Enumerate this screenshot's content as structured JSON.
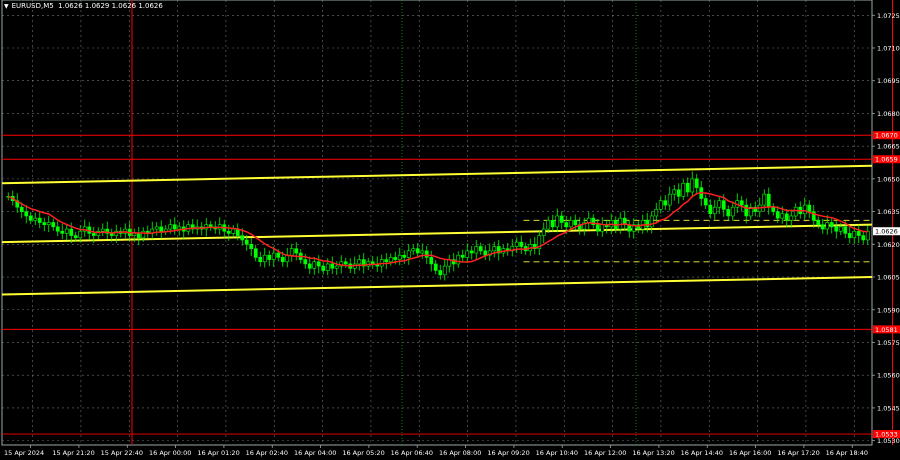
{
  "header": {
    "symbol": "EURUSD,M5",
    "ohlc": "1.0626 1.0629 1.0626 1.0626",
    "arrow": "▼"
  },
  "colors": {
    "background": "#000000",
    "grid": "#9aa7a7",
    "candle": "#00ff00",
    "ma": "#ff2020",
    "channel": "#ffff33",
    "level_line": "#ff0000",
    "session_line": "#ff0000",
    "session_dotted": "#00aa00",
    "price_label_bg": "#ff0000",
    "current_price_bg": "#ffffff"
  },
  "chart_data": {
    "type": "candlestick",
    "symbol": "EURUSD",
    "timeframe": "M5",
    "ylim": [
      1.0528,
      1.0732
    ],
    "y_ticks": [
      "1.0725",
      "1.0710",
      "1.0695",
      "1.0680",
      "1.0665",
      "1.0650",
      "1.0635",
      "1.0620",
      "1.0605",
      "1.0590",
      "1.0575",
      "1.0560",
      "1.0545",
      "1.0530"
    ],
    "x_ticks": [
      "15 Apr 2024",
      "15 Apr 21:20",
      "15 Apr 22:40",
      "16 Apr 00:00",
      "16 Apr 01:20",
      "16 Apr 02:40",
      "16 Apr 04:00",
      "16 Apr 05:20",
      "16 Apr 06:40",
      "16 Apr 08:00",
      "16 Apr 09:20",
      "16 Apr 10:40",
      "16 Apr 12:00",
      "16 Apr 13:20",
      "16 Apr 14:40",
      "16 Apr 16:00",
      "16 Apr 17:20",
      "16 Apr 18:40"
    ],
    "price_labels": [
      {
        "text": "1.0670",
        "value": 1.067
      },
      {
        "text": "1.0659",
        "value": 1.0659
      },
      {
        "text": "1.0581",
        "value": 1.0581
      },
      {
        "text": "1.0533",
        "value": 1.0533
      }
    ],
    "current_price": {
      "text": "1.0626",
      "value": 1.0626
    },
    "horizontal_levels": [
      1.067,
      1.0659,
      1.0581,
      1.0533
    ],
    "channel_lines": [
      {
        "x_start": 0,
        "x_end": 216,
        "y_start": 1.0648,
        "y_end": 1.0656
      },
      {
        "x_start": 0,
        "x_end": 216,
        "y_start": 1.0621,
        "y_end": 1.0629
      },
      {
        "x_start": 0,
        "x_end": 216,
        "y_start": 1.0597,
        "y_end": 1.0605
      }
    ],
    "dashed_levels": [
      1.0631,
      1.0612
    ],
    "session_lines": [
      28,
      197
    ],
    "close_series": [
      1.0642,
      1.064,
      1.0637,
      1.0635,
      1.0633,
      1.0631,
      1.0632,
      1.063,
      1.0629,
      1.063,
      1.0628,
      1.0626,
      1.0625,
      1.0627,
      1.0624,
      1.0623,
      1.0626,
      1.0628,
      1.0625,
      1.0624,
      1.0626,
      1.0627,
      1.0625,
      1.0624,
      1.0626,
      1.0625,
      1.0627,
      1.0624,
      1.0625,
      1.0623,
      1.0626,
      1.0625,
      1.0627,
      1.0628,
      1.0626,
      1.0627,
      1.0629,
      1.0627,
      1.0628,
      1.0626,
      1.0629,
      1.0627,
      1.0628,
      1.0627,
      1.0629,
      1.0628,
      1.0627,
      1.0629,
      1.0626,
      1.0625,
      1.0627,
      1.0624,
      1.0622,
      1.062,
      1.0618,
      1.0614,
      1.0612,
      1.0615,
      1.0613,
      1.0616,
      1.0614,
      1.0612,
      1.0615,
      1.0618,
      1.0616,
      1.0613,
      1.0611,
      1.0609,
      1.0612,
      1.061,
      1.0608,
      1.0611,
      1.0609,
      1.061,
      1.0612,
      1.0611,
      1.0609,
      1.0611,
      1.0613,
      1.061,
      1.0612,
      1.0611,
      1.061,
      1.0613,
      1.0612,
      1.0614,
      1.0613,
      1.0615,
      1.0614,
      1.0617,
      1.0618,
      1.0616,
      1.0617,
      1.0614,
      1.0611,
      1.0608,
      1.0606,
      1.061,
      1.0613,
      1.0611,
      1.0615,
      1.0614,
      1.0617,
      1.0616,
      1.0619,
      1.0617,
      1.0615,
      1.0617,
      1.0619,
      1.0616,
      1.0618,
      1.0617,
      1.0619,
      1.0621,
      1.0619,
      1.0617,
      1.062,
      1.0618,
      1.0624,
      1.0627,
      1.0631,
      1.0628,
      1.0633,
      1.063,
      1.0628,
      1.0631,
      1.0629,
      1.0627,
      1.063,
      1.0632,
      1.0629,
      1.0626,
      1.0629,
      1.0628,
      1.0631,
      1.0627,
      1.0632,
      1.0629,
      1.0626,
      1.0629,
      1.0627,
      1.0631,
      1.0628,
      1.0633,
      1.0636,
      1.064,
      1.0638,
      1.0643,
      1.0645,
      1.0642,
      1.0648,
      1.0644,
      1.065,
      1.0646,
      1.0641,
      1.0638,
      1.0634,
      1.0637,
      1.064,
      1.0636,
      1.0633,
      1.0637,
      1.064,
      1.0638,
      1.0633,
      1.0637,
      1.0635,
      1.0638,
      1.0643,
      1.0637,
      1.0635,
      1.0632,
      1.0634,
      1.0631,
      1.0633,
      1.0637,
      1.0634,
      1.0638,
      1.0635,
      1.0631,
      1.0629,
      1.0627,
      1.063,
      1.0628,
      1.0626,
      1.0628,
      1.0625,
      1.0623,
      1.0626,
      1.0624,
      1.0622,
      1.0626
    ]
  }
}
